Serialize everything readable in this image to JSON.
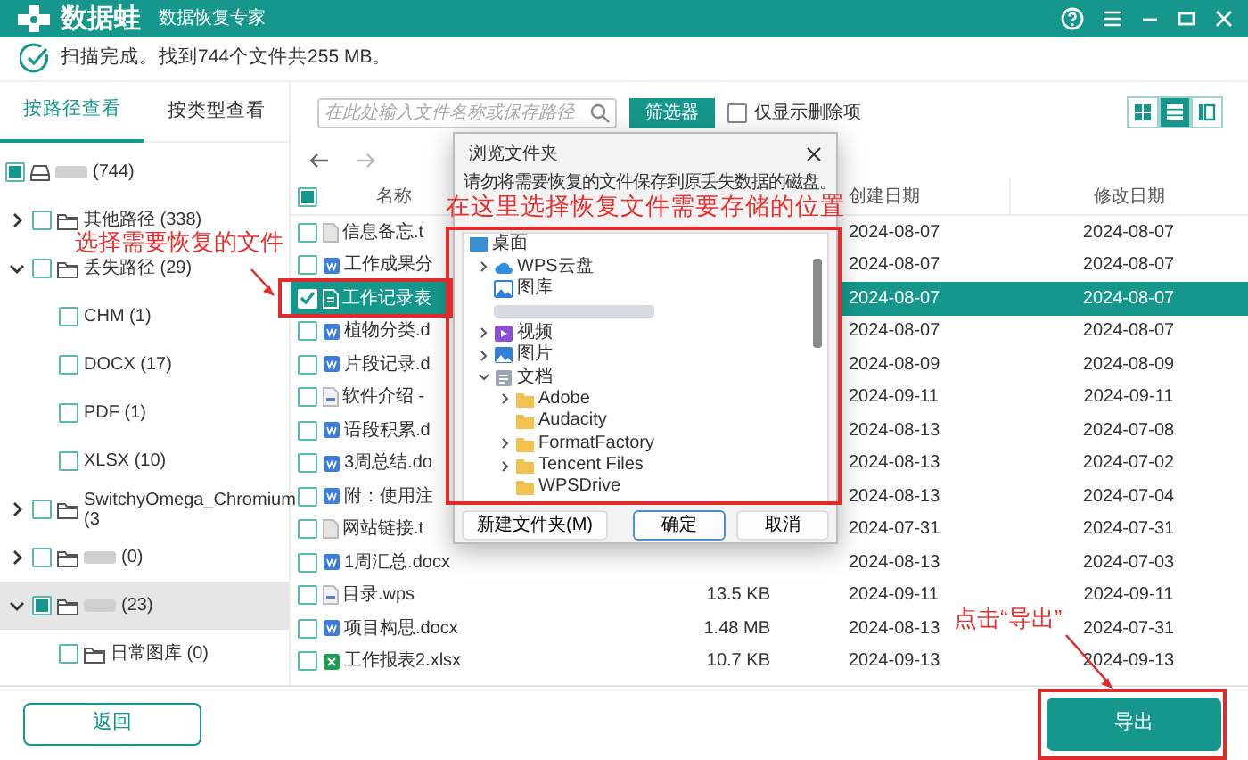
{
  "app": {
    "logo": "数据蛙",
    "subtitle": "数据恢复专家"
  },
  "status": "扫描完成。找到744个文件共255 MB。",
  "view_tabs": [
    {
      "label": "按路径查看",
      "selected": true
    },
    {
      "label": "按类型查看",
      "selected": false
    }
  ],
  "tree": [
    {
      "label": "(744)",
      "kind": "drive",
      "blurred": true,
      "checked": false,
      "indeterminate": true,
      "selected": false,
      "children": [
        {
          "label": "其他路径 (338)",
          "kind": "folder",
          "checked": false,
          "indeterminate": false,
          "expanded": false,
          "selected": false
        },
        {
          "label": "丢失路径 (29)",
          "kind": "folder",
          "checked": false,
          "indeterminate": false,
          "expanded": true,
          "selected": false,
          "children": [
            {
              "label": "CHM (1)",
              "kind": "type",
              "checked": false,
              "indeterminate": false,
              "selected": false
            },
            {
              "label": "DOCX (17)",
              "kind": "type",
              "checked": false,
              "indeterminate": false,
              "selected": false
            },
            {
              "label": "PDF (1)",
              "kind": "type",
              "checked": false,
              "indeterminate": false,
              "selected": false
            },
            {
              "label": "XLSX (10)",
              "kind": "type",
              "checked": false,
              "indeterminate": false,
              "selected": false
            }
          ]
        },
        {
          "label": "SwitchyOmega_Chromium (3",
          "kind": "folder",
          "checked": false,
          "indeterminate": false,
          "expanded": false,
          "selected": false
        },
        {
          "label": "(0)",
          "kind": "folder",
          "blurred": true,
          "checked": false,
          "indeterminate": false,
          "expanded": false,
          "selected": false
        },
        {
          "label": "(23)",
          "kind": "folder",
          "blurred": true,
          "checked": false,
          "indeterminate": true,
          "expanded": true,
          "selected": true,
          "children": [
            {
              "label": "日常图库 (0)",
              "kind": "folder",
              "checked": false,
              "indeterminate": false,
              "selected": false
            }
          ]
        }
      ]
    }
  ],
  "toolbar": {
    "search": {
      "placeholder": "在此处输入文件名称或保存路径"
    },
    "filter_button": "筛选器",
    "deleted_only": {
      "label": "仅显示删除项",
      "checked": false
    },
    "view_modes": [
      {
        "kind": "grid",
        "selected": false
      },
      {
        "kind": "list",
        "selected": true
      },
      {
        "kind": "columns",
        "selected": false
      }
    ]
  },
  "table": {
    "header_checkbox": {
      "checked": false,
      "indeterminate": true
    },
    "columns": {
      "name": "名称",
      "created": "创建日期",
      "modified": "修改日期"
    },
    "rows": [
      {
        "name": "信息备忘.t",
        "kind": "text",
        "created": "2024-08-07",
        "modified": "2024-08-07",
        "checked": false,
        "selected": false
      },
      {
        "name": "工作成果分",
        "kind": "word",
        "created": "2024-08-07",
        "modified": "2024-08-07",
        "checked": false,
        "selected": false
      },
      {
        "name": "工作记录表",
        "kind": "sheet",
        "created": "2024-08-07",
        "modified": "2024-08-07",
        "checked": true,
        "selected": true
      },
      {
        "name": "植物分类.d",
        "kind": "word",
        "created": "2024-08-07",
        "modified": "2024-08-07",
        "checked": false,
        "selected": false
      },
      {
        "name": "片段记录.d",
        "kind": "word",
        "created": "2024-08-09",
        "modified": "2024-08-09",
        "checked": false,
        "selected": false
      },
      {
        "name": "软件介绍 -",
        "kind": "wps",
        "created": "2024-09-11",
        "modified": "2024-09-11",
        "checked": false,
        "selected": false
      },
      {
        "name": "语段积累.d",
        "kind": "word",
        "created": "2024-08-13",
        "modified": "2024-07-08",
        "checked": false,
        "selected": false
      },
      {
        "name": "3周总结.do",
        "kind": "word",
        "created": "2024-08-13",
        "modified": "2024-07-02",
        "checked": false,
        "selected": false
      },
      {
        "name": "附：使用注",
        "kind": "word",
        "created": "2024-08-13",
        "modified": "2024-07-04",
        "checked": false,
        "selected": false
      },
      {
        "name": "网站链接.t",
        "kind": "text",
        "created": "2024-07-31",
        "modified": "2024-07-31",
        "checked": false,
        "selected": false
      },
      {
        "name": "1周汇总.docx",
        "kind": "word",
        "created": "2024-08-13",
        "modified": "2024-07-03",
        "checked": false,
        "selected": false
      },
      {
        "name": "目录.wps",
        "kind": "wps",
        "size": "13.5 KB",
        "created": "2024-09-11",
        "modified": "2024-09-11",
        "checked": false,
        "selected": false
      },
      {
        "name": "项目构思.docx",
        "kind": "word",
        "size": "1.48 MB",
        "created": "2024-08-13",
        "modified": "2024-07-31",
        "checked": false,
        "selected": false
      },
      {
        "name": "工作报表2.xlsx",
        "kind": "excel",
        "size": "10.7 KB",
        "created": "2024-09-13",
        "modified": "2024-09-13",
        "checked": false,
        "selected": false
      }
    ]
  },
  "dialog": {
    "title": "浏览文件夹",
    "message": "请勿将需要恢复的文件保存到原丢失数据的磁盘。",
    "tree": [
      {
        "label": "桌面",
        "kind": "desktop",
        "children": [
          {
            "label": "WPS云盘",
            "kind": "cloud",
            "expanded": false
          },
          {
            "label": "图库",
            "kind": "gallery"
          },
          {
            "kind": "blurred"
          },
          {
            "label": "视频",
            "kind": "video",
            "expanded": false
          },
          {
            "label": "图片",
            "kind": "pictures",
            "expanded": false
          },
          {
            "label": "文档",
            "kind": "documents",
            "expanded": true,
            "children": [
              {
                "label": "Adobe",
                "kind": "folder",
                "expanded": false
              },
              {
                "label": "Audacity",
                "kind": "folder"
              },
              {
                "label": "FormatFactory",
                "kind": "folder",
                "expanded": false
              },
              {
                "label": "Tencent Files",
                "kind": "folder",
                "expanded": false
              },
              {
                "label": "WPSDrive",
                "kind": "folder"
              }
            ]
          }
        ]
      }
    ],
    "buttons": [
      {
        "label": "新建文件夹(M)",
        "default": false
      },
      {
        "label": "确定",
        "default": true
      },
      {
        "label": "取消",
        "default": false
      }
    ]
  },
  "footer": {
    "back": "返回",
    "export": "导出"
  },
  "annotations": [
    {
      "text": "选择需要恢复的文件"
    },
    {
      "text": "在这里选择恢复文件需要存储的位置"
    },
    {
      "text": "点击“导出”"
    }
  ]
}
